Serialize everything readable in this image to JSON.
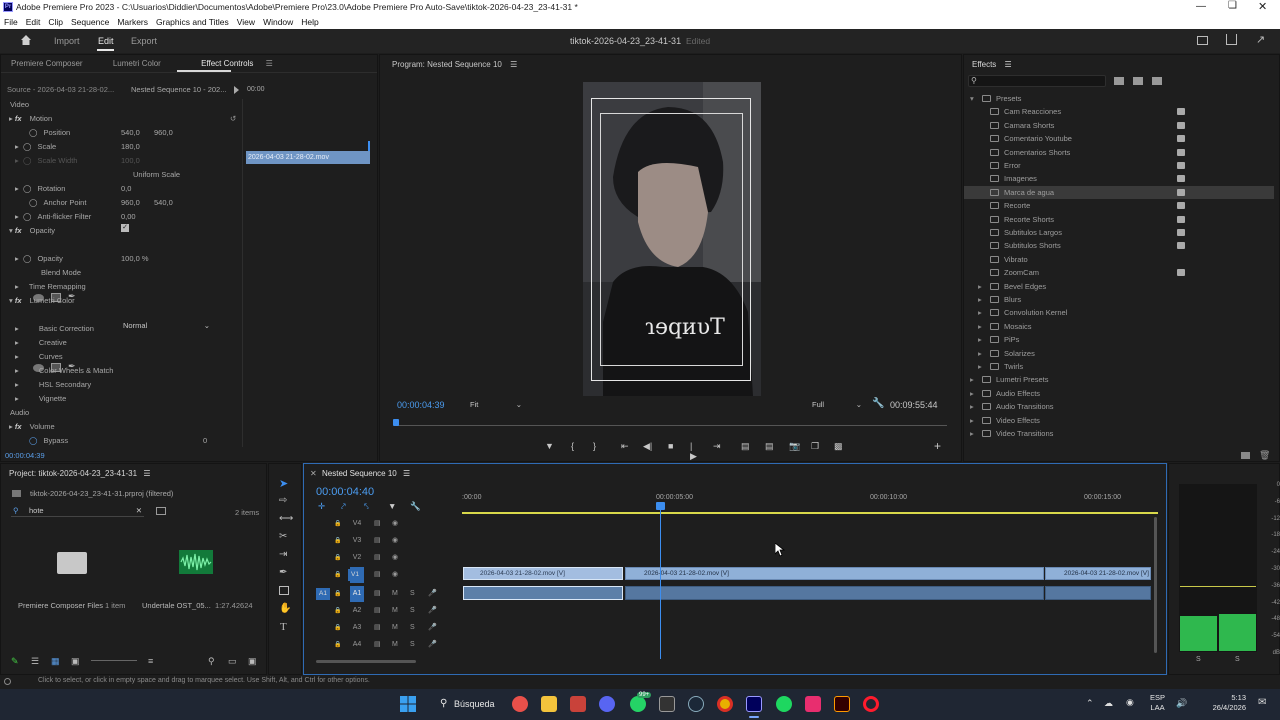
{
  "titlebar": {
    "title": "Adobe Premiere Pro 2023 - C:\\Usuarios\\Diddier\\Documentos\\Adobe\\Premiere Pro\\23.0\\Adobe Premiere Pro Auto-Save\\tiktok-2026-04-23_23-41-31 *",
    "logo": "Pr"
  },
  "menu": [
    "File",
    "Edit",
    "Clip",
    "Sequence",
    "Markers",
    "Graphics and Titles",
    "View",
    "Window",
    "Help"
  ],
  "workspace": {
    "tabs": [
      "Import",
      "Edit",
      "Export"
    ],
    "active": "Edit",
    "project_name": "tiktok-2026-04-23_23-41-31",
    "status": "Edited"
  },
  "effect_controls": {
    "tabs": [
      "Premiere Composer",
      "Lumetri Color",
      "Effect Controls"
    ],
    "source": "Source - 2026-04-03 21-28-02...",
    "sequence": "Nested Sequence 10 - 202...",
    "clip_time": "00:00",
    "clip_name": "2026-04-03 21-28-02.mov",
    "section_video": "Video",
    "motion": "Motion",
    "position_label": "Position",
    "position_x": "540,0",
    "position_y": "960,0",
    "scale_label": "Scale",
    "scale_value": "180,0",
    "scale_width_label": "Scale Width",
    "scale_width_value": "100,0",
    "uniform_scale": "Uniform Scale",
    "rotation_label": "Rotation",
    "rotation_value": "0,0",
    "anchor_label": "Anchor Point",
    "anchor_x": "960,0",
    "anchor_y": "540,0",
    "antiflicker_label": "Anti-flicker Filter",
    "antiflicker_value": "0,00",
    "opacity_section": "Opacity",
    "opacity_label": "Opacity",
    "opacity_value": "100,0 %",
    "blend_label": "Blend Mode",
    "blend_value": "Normal",
    "time_remap": "Time Remapping",
    "lumetri": "Lumetri Color",
    "lumetri_items": [
      "Basic Correction",
      "Creative",
      "Curves",
      "Color Wheels & Match",
      "HSL Secondary",
      "Vignette"
    ],
    "section_audio": "Audio",
    "volume": "Volume",
    "bypass": "Bypass",
    "bypass_value": "0",
    "footer_time": "00:00:04:39"
  },
  "program": {
    "title": "Program: Nested Sequence 10",
    "timecode": "00:00:04:39",
    "fit": "Fit",
    "quality": "Full",
    "duration": "00:09:55:44",
    "shirt_text": "ɿɘqиυT"
  },
  "effects_panel": {
    "title": "Effects",
    "presets_label": "Presets",
    "presets": [
      "Cam Reacciones",
      "Camara Shorts",
      "Comentario Youtube",
      "Comentarios Shorts",
      "Error",
      "Imagenes",
      "Marca de agua",
      "Recorte",
      "Recorte Shorts",
      "Subtitulos Largos",
      "Subtitulos Shorts",
      "Vibrato",
      "ZoomCam"
    ],
    "preset_folders": [
      "Bevel Edges",
      "Blurs",
      "Convolution Kernel",
      "Mosaics",
      "PiPs",
      "Solarizes",
      "Twirls"
    ],
    "top_folders": [
      "Lumetri Presets",
      "Audio Effects",
      "Audio Transitions",
      "Video Effects",
      "Video Transitions"
    ],
    "selected": "Marca de agua"
  },
  "project": {
    "title": "Project: tiktok-2026-04-23_23-41-31",
    "file": "tiktok-2026-04-23_23-41-31.prproj (filtered)",
    "search_value": "hote",
    "items_count": "2 items",
    "item1_name": "Premiere Composer Files",
    "item1_meta": "1 item",
    "item2_name": "Undertale OST_05...",
    "item2_meta": "1:27.42624"
  },
  "timeline": {
    "title": "Nested Sequence 10",
    "timecode": "00:00:04:40",
    "ruler": [
      ":00:00",
      "00:00:05:00",
      "00:00:10:00",
      "00:00:15:00"
    ],
    "tracks": [
      "V4",
      "V3",
      "V2",
      "V1",
      "A1",
      "A2",
      "A3",
      "A4"
    ],
    "clip1": "2026-04-03 21-28-02.mov [V]",
    "clip2": "2026-04-03 21-28-02.mov [V]",
    "clip3": "2026-04-03 21-28-02.mov [V]",
    "v1_src": "V1",
    "a1_src": "A1"
  },
  "meters": {
    "labels": [
      "0",
      "-6",
      "-12",
      "-18",
      "-24",
      "-30",
      "-36",
      "-42",
      "-48",
      "-54",
      "dB"
    ],
    "solo": "S"
  },
  "statusbar": {
    "text": "Click to select, or click in empty space and drag to marquee select. Use Shift, Alt, and Ctrl for other options."
  },
  "taskbar": {
    "search": "Búsqueda",
    "lang1": "ESP",
    "lang2": "LAA",
    "time": "5:13",
    "date": "26/4/2026",
    "badge": "99+"
  }
}
